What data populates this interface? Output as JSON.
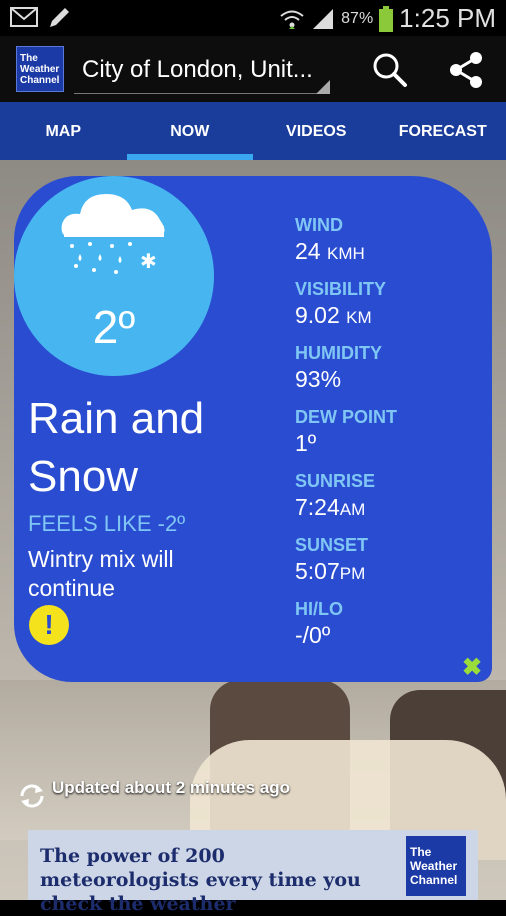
{
  "status_bar": {
    "battery": "87%",
    "time": "1:25 PM"
  },
  "app_bar": {
    "logo_lines": [
      "The",
      "Weather",
      "Channel"
    ],
    "location": "City of London, Unit..."
  },
  "tabs": [
    {
      "label": "MAP",
      "active": false
    },
    {
      "label": "NOW",
      "active": true
    },
    {
      "label": "VIDEOS",
      "active": false
    },
    {
      "label": "FORECAST",
      "active": false
    }
  ],
  "current": {
    "temperature": "2º",
    "condition_lines": [
      "Rain and",
      "Snow"
    ],
    "feels_like": "FEELS LIKE -2º",
    "summary": "Wintry mix will continue"
  },
  "stats": [
    {
      "label": "WIND",
      "value": "24",
      "unit": "KMH"
    },
    {
      "label": "VISIBILITY",
      "value": "9.02",
      "unit": "KM"
    },
    {
      "label": "HUMIDITY",
      "value": "93%",
      "unit": ""
    },
    {
      "label": "DEW POINT",
      "value": "1º",
      "unit": ""
    },
    {
      "label": "SUNRISE",
      "value": "7:24",
      "unit": "AM"
    },
    {
      "label": "SUNSET",
      "value": "5:07",
      "unit": "PM"
    },
    {
      "label": "HI/LO",
      "value": "-/0º",
      "unit": ""
    }
  ],
  "updated": "Updated about 2 minutes ago",
  "ad": {
    "text": "The power of 200 meteorologists every time you check the weather",
    "logo_lines": [
      "The",
      "Weather",
      "Channel"
    ]
  },
  "colors": {
    "card": "#2a4cd0",
    "accent": "#7fc6f4",
    "tab_bar": "#1a3c9a",
    "tab_indicator": "#3aa8f0",
    "alert": "#f4e21c"
  }
}
